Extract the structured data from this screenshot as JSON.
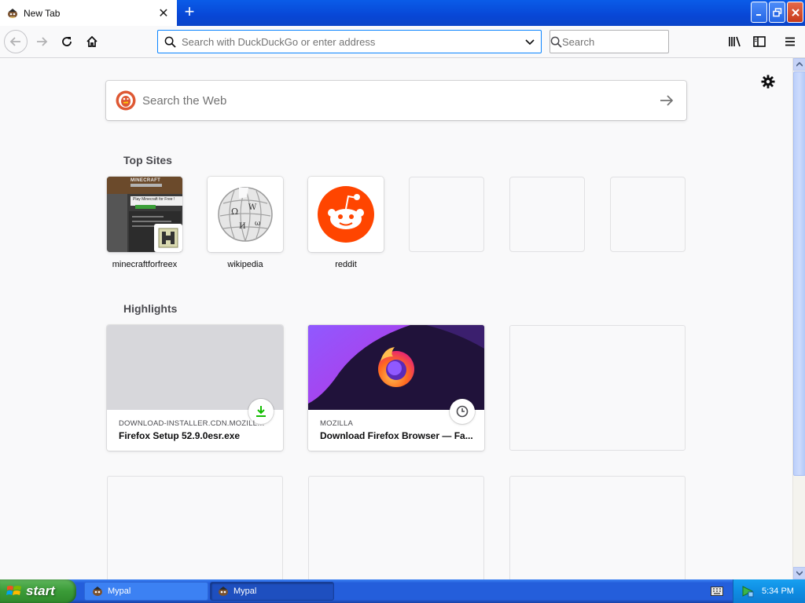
{
  "tab": {
    "title": "New Tab",
    "close_glyph": "✕",
    "new_tab_glyph": "+"
  },
  "window_controls": {
    "minimize": "minimize-icon",
    "maximize": "restore-icon",
    "close": "close-icon"
  },
  "toolbar": {
    "url_placeholder": "Search with DuckDuckGo or enter address",
    "search_placeholder": "Search",
    "icons": [
      "back-arrow-icon",
      "forward-arrow-icon",
      "reload-icon",
      "home-icon",
      "library-icon",
      "sidebar-icon",
      "hamburger-menu-icon"
    ]
  },
  "newtab": {
    "search_placeholder": "Search the Web",
    "top_sites_title": "Top Sites",
    "highlights_title": "Highlights",
    "top_sites": [
      {
        "label": "minecraftforfreex"
      },
      {
        "label": "wikipedia"
      },
      {
        "label": "reddit"
      },
      {
        "label": ""
      },
      {
        "label": ""
      },
      {
        "label": ""
      }
    ],
    "highlights": [
      {
        "host": "DOWNLOAD-INSTALLER.CDN.MOZILLA ...",
        "title": "Firefox Setup 52.9.0esr.exe",
        "badge": "download-icon"
      },
      {
        "host": "MOZILLA",
        "title": "Download Firefox Browser — Fa...",
        "badge": "clock-icon"
      }
    ],
    "minecraft_thumb": {
      "logo_text": "MINECRAFT",
      "tagline": "Play Minecraft for Free !"
    }
  },
  "taskbar": {
    "start_label": "start",
    "tasks": [
      {
        "label": "Mypal"
      },
      {
        "label": "Mypal"
      }
    ],
    "clock": "5:34 PM"
  },
  "colors": {
    "accent": "#0a84ff",
    "taskbar": "#245edb",
    "start": "#3a9b37",
    "reddit": "#ff4500"
  }
}
